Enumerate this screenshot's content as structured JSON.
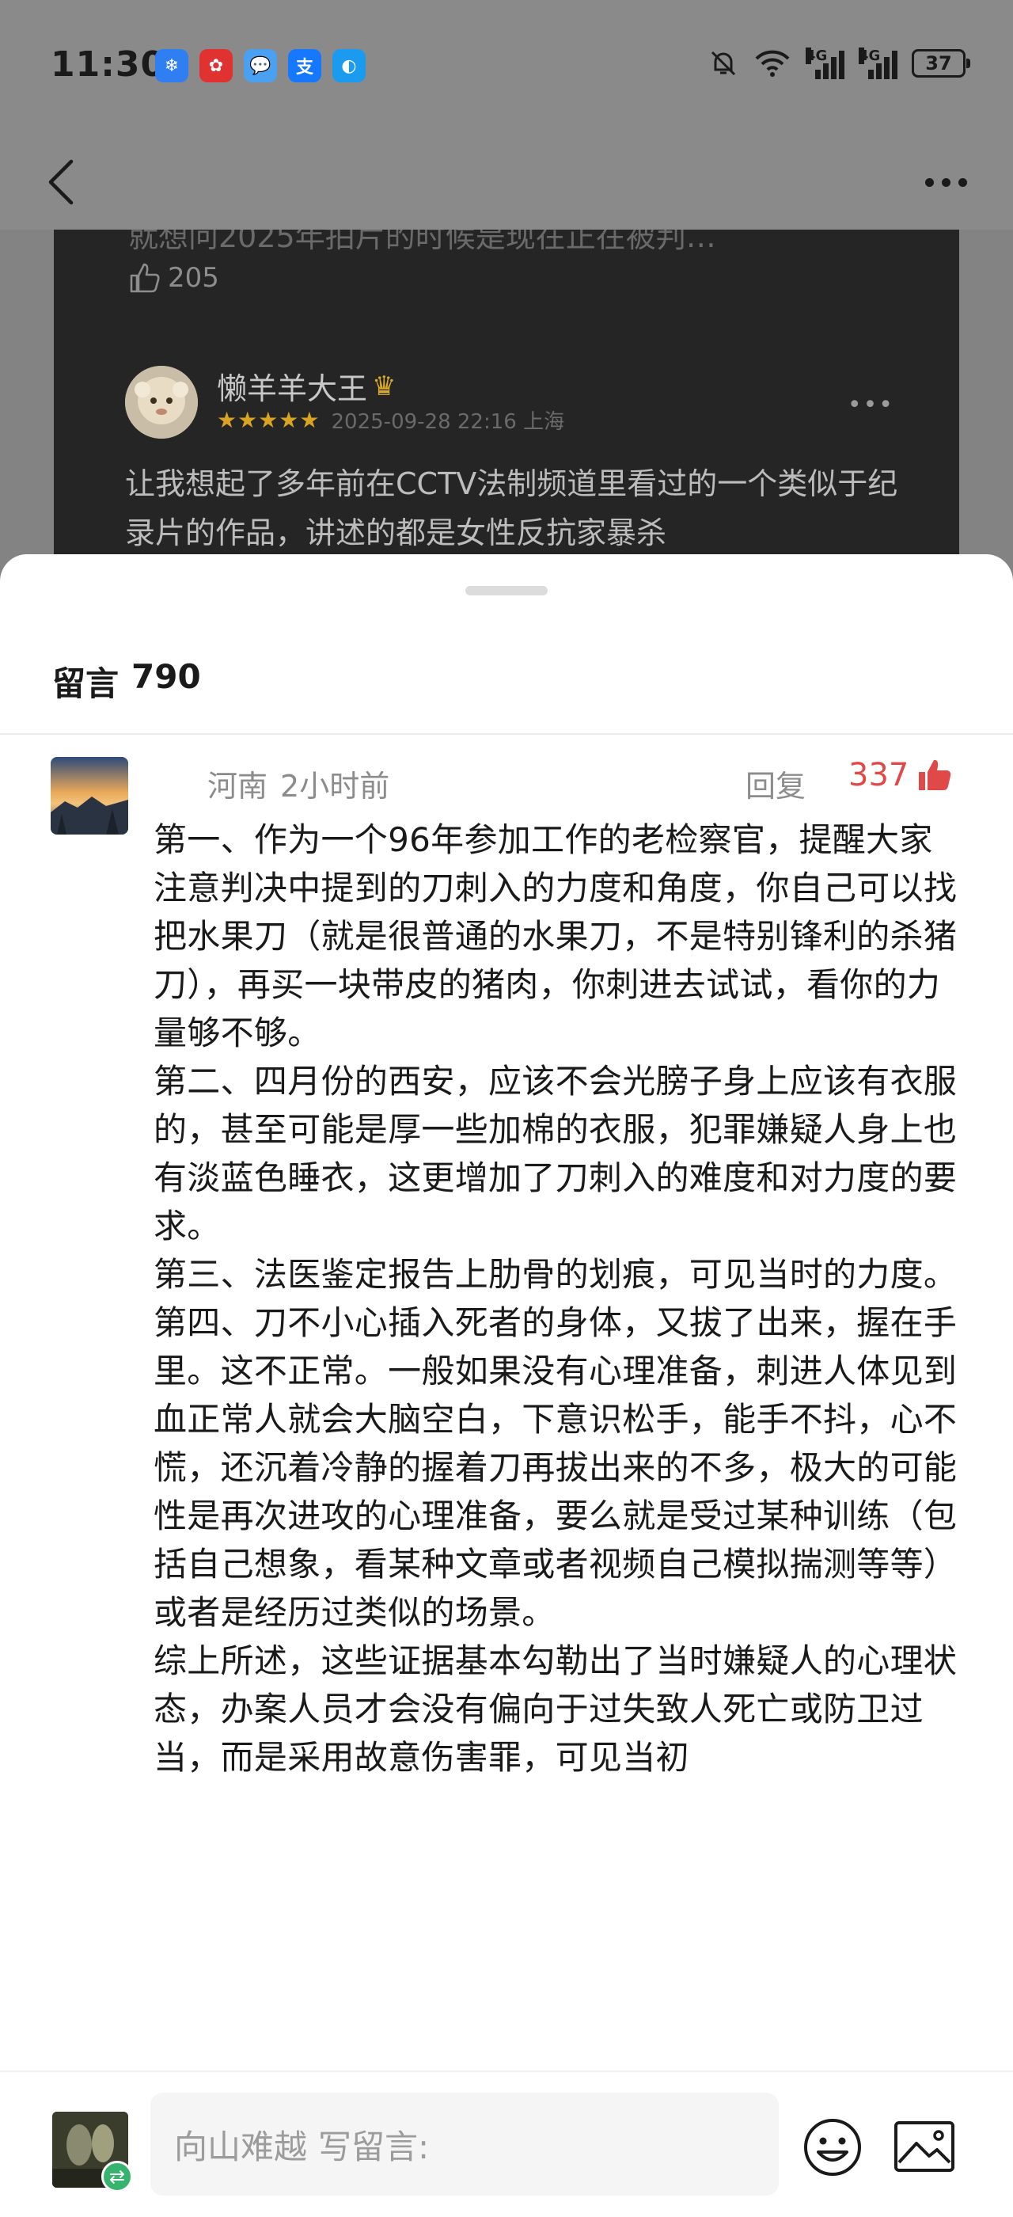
{
  "status_bar": {
    "time": "11:30",
    "apps": [
      {
        "icon": "app-blue-icon",
        "label": "❄",
        "color": "#2f7ff2"
      },
      {
        "icon": "app-red-icon",
        "label": "✿",
        "color": "#e13232"
      },
      {
        "icon": "chat-bubble-icon",
        "label": "💬",
        "color": "#4aa1f2"
      },
      {
        "icon": "alipay-icon",
        "label": "支",
        "color": "#1677ff"
      },
      {
        "icon": "qq-icon",
        "label": "◐",
        "color": "#1b9bf0"
      }
    ],
    "network_1": "4G",
    "network_2": "4G",
    "battery": "37"
  },
  "background": {
    "cut_text": "就想问2025年拍片的时候是现在正在被判…",
    "like_count": "205",
    "username": "懒羊羊大王",
    "stars": "★★★★★",
    "date_location": "2025-09-28 22:16 上海",
    "body": "让我想起了多年前在CCTV法制频道里看过的一个类似于纪录片的作品，讲述的都是女性反抗家暴杀"
  },
  "sheet": {
    "title": "留言",
    "count": "790"
  },
  "comment": {
    "location": "河南",
    "time_ago": "2小时前",
    "reply_label": "回复",
    "like_count": "337",
    "paragraphs": [
      "第一、作为一个96年参加工作的老检察官，提醒大家注意判决中提到的刀刺入的力度和角度，你自己可以找把水果刀（就是很普通的水果刀，不是特别锋利的杀猪刀），再买一块带皮的猪肉，你刺进去试试，看你的力量够不够。",
      "第二、四月份的西安，应该不会光膀子身上应该有衣服的，甚至可能是厚一些加棉的衣服，犯罪嫌疑人身上也有淡蓝色睡衣，这更增加了刀刺入的难度和对力度的要求。",
      "第三、法医鉴定报告上肋骨的划痕，可见当时的力度。",
      "第四、刀不小心插入死者的身体，又拔了出来，握在手里。这不正常。一般如果没有心理准备，刺进人体见到血正常人就会大脑空白，下意识松手，能手不抖，心不慌，还沉着冷静的握着刀再拔出来的不多，极大的可能性是再次进攻的心理准备，要么就是受过某种训练（包括自己想象，看某种文章或者视频自己模拟揣测等等）或者是经历过类似的场景。",
      "综上所述，这些证据基本勾勒出了当时嫌疑人的心理状态，办案人员才会没有偏向于过失致人死亡或防卫过当，而是采用故意伤害罪，可见当初"
    ]
  },
  "input": {
    "username": "向山难越",
    "placeholder": "写留言:"
  },
  "colors": {
    "like_red": "#e14848",
    "swap_green": "#36b36c",
    "crown_gold": "#d8a928"
  }
}
